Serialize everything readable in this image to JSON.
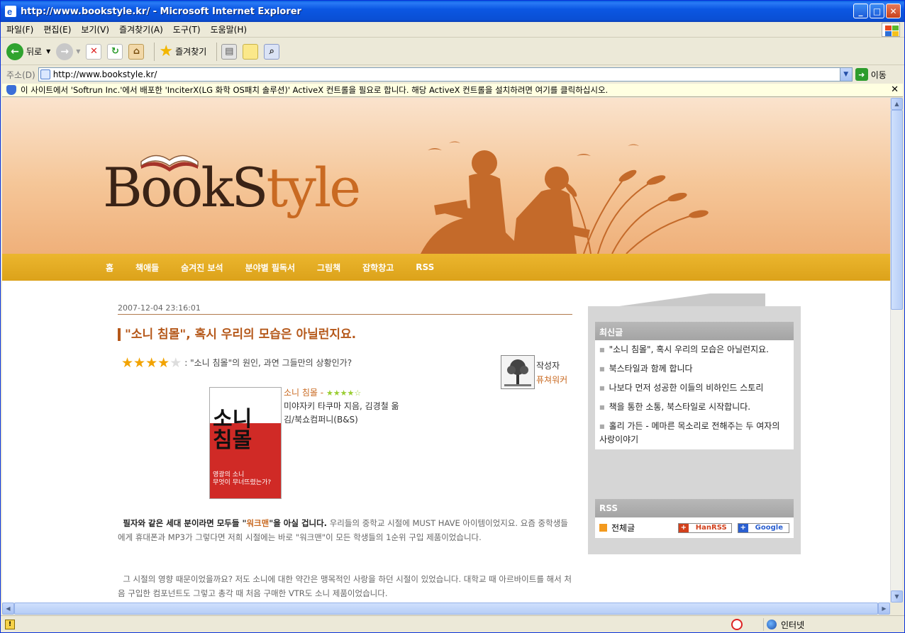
{
  "window": {
    "title": "http://www.bookstyle.kr/ - Microsoft Internet Explorer",
    "buttons": [
      "_",
      "□",
      "✕"
    ]
  },
  "menu": [
    "파일(F)",
    "편집(E)",
    "보기(V)",
    "즐겨찾기(A)",
    "도구(T)",
    "도움말(H)"
  ],
  "toolbar": {
    "back_label": "뒤로",
    "favorites_label": "즐겨찾기"
  },
  "address": {
    "label": "주소(D)",
    "url": "http://www.bookstyle.kr/",
    "go_label": "이동"
  },
  "infobar": {
    "text": "이 사이트에서 'Softrun Inc.'에서 배포한 'InciterX(LG 화학 OS패치 솔루션)' ActiveX 컨트롤을 필요로 합니다. 해당 ActiveX 컨트롤을 설치하려면 여기를 클릭하십시오."
  },
  "site": {
    "logo_main": "BookS",
    "logo_rest": "tyle",
    "nav": [
      "홈",
      "책애들",
      "숨겨진 보석",
      "분야별 필독서",
      "그림책",
      "잡학창고",
      "RSS"
    ]
  },
  "post": {
    "date": "2007-12-04 23:16:01",
    "title": "\"소니 침몰\", 혹시 우리의 모습은 아닐런지요.",
    "rating": 4,
    "rating_max": 5,
    "subtitle": ": \"소니 침몰\"의 원인, 과연 그들만의 상황인가?",
    "author_label": "작성자",
    "author_name": "퓨쳐워커",
    "book": {
      "title": "소니 침몰",
      "dash": " - ",
      "stars": "★★★★☆",
      "credits": "미야자키 타쿠마 지음, 김경철 옮김/북쇼컴퍼니(B&S)",
      "cover_title": "소니\n침몰",
      "cover_sub": "영광의 소니\n무엇이 무너뜨렸는가?"
    },
    "para1_bold_a": "필자와 같은 세대 분이라면 모두들 \"",
    "para1_hl": "워크맨",
    "para1_bold_b": "\"을 아실 겁니다.",
    "para1_rest": " 우리들의 중학교 시절에 MUST HAVE 아이템이었지요. 요즘 중학생들에게 휴대폰과 MP3가 그렇다면 저희 시절에는 바로 \"워크맨\"이 모든 학생들의 1순위 구입 제품이었습니다.",
    "para2": "그 시절의 영향 때문이었을까요? 저도 소니에 대한 약간은 맹목적인 사랑을 하던 시절이 있었습니다. 대학교 때 아르바이트를 해서 처음 구입한 컴포넌트도 그렇고 총각 때 처음 구매한 VTR도 소니 제품이었습니다."
  },
  "sidebar": {
    "recent_header": "최신글",
    "recent": [
      "\"소니 침몰\", 혹시 우리의 모습은 아닐런지요.",
      "북스타일과 함께 합니다",
      "나보다 먼저 성공한 이들의 비하인드 스토리",
      "책을 통한 소통, 북스타일로 시작합니다.",
      "홀리 가든 - 메마른 목소리로 전해주는 두 여자의 사랑이야기"
    ],
    "rss_header": "RSS",
    "rss_all": "전체글",
    "hanrss": "HanRSS",
    "google": "Google"
  },
  "status": {
    "zone": "인터넷"
  },
  "colors": {
    "accent": "#c96a22",
    "nav": "#e0a823",
    "title_bar": "#0a54e0"
  }
}
